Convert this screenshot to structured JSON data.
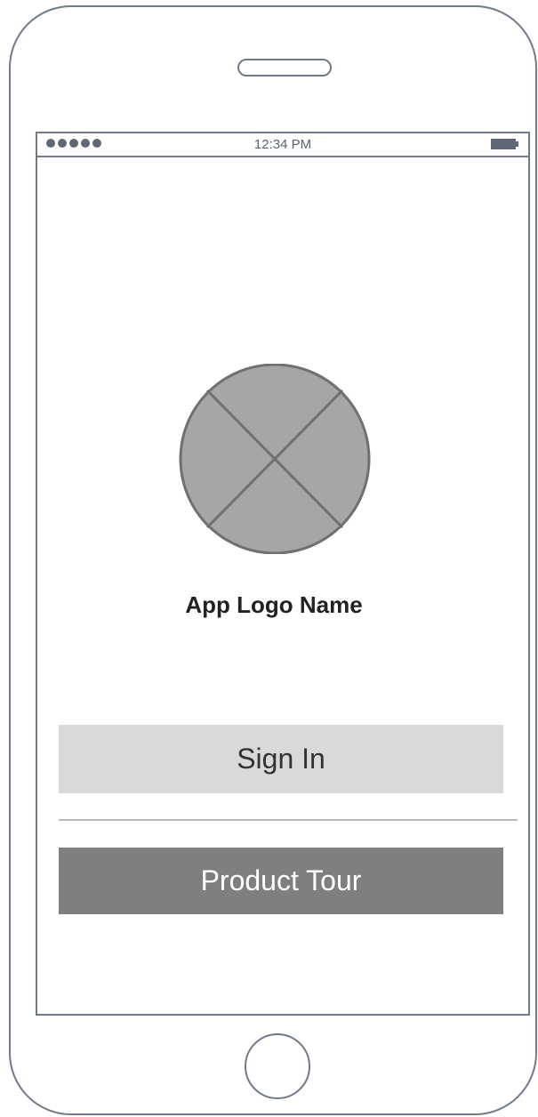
{
  "status_bar": {
    "time": "12:34 PM",
    "signal_icon": "signal-dots-icon",
    "battery_icon": "battery-icon"
  },
  "logo": {
    "icon": "image-placeholder-icon",
    "name": "App Logo Name"
  },
  "buttons": {
    "sign_in": "Sign In",
    "product_tour": "Product Tour"
  },
  "colors": {
    "outline": "#707a88",
    "logo_fill": "#a6a6a6",
    "sign_in_bg": "#d9d9d9",
    "product_tour_bg": "#7f7f7f"
  }
}
